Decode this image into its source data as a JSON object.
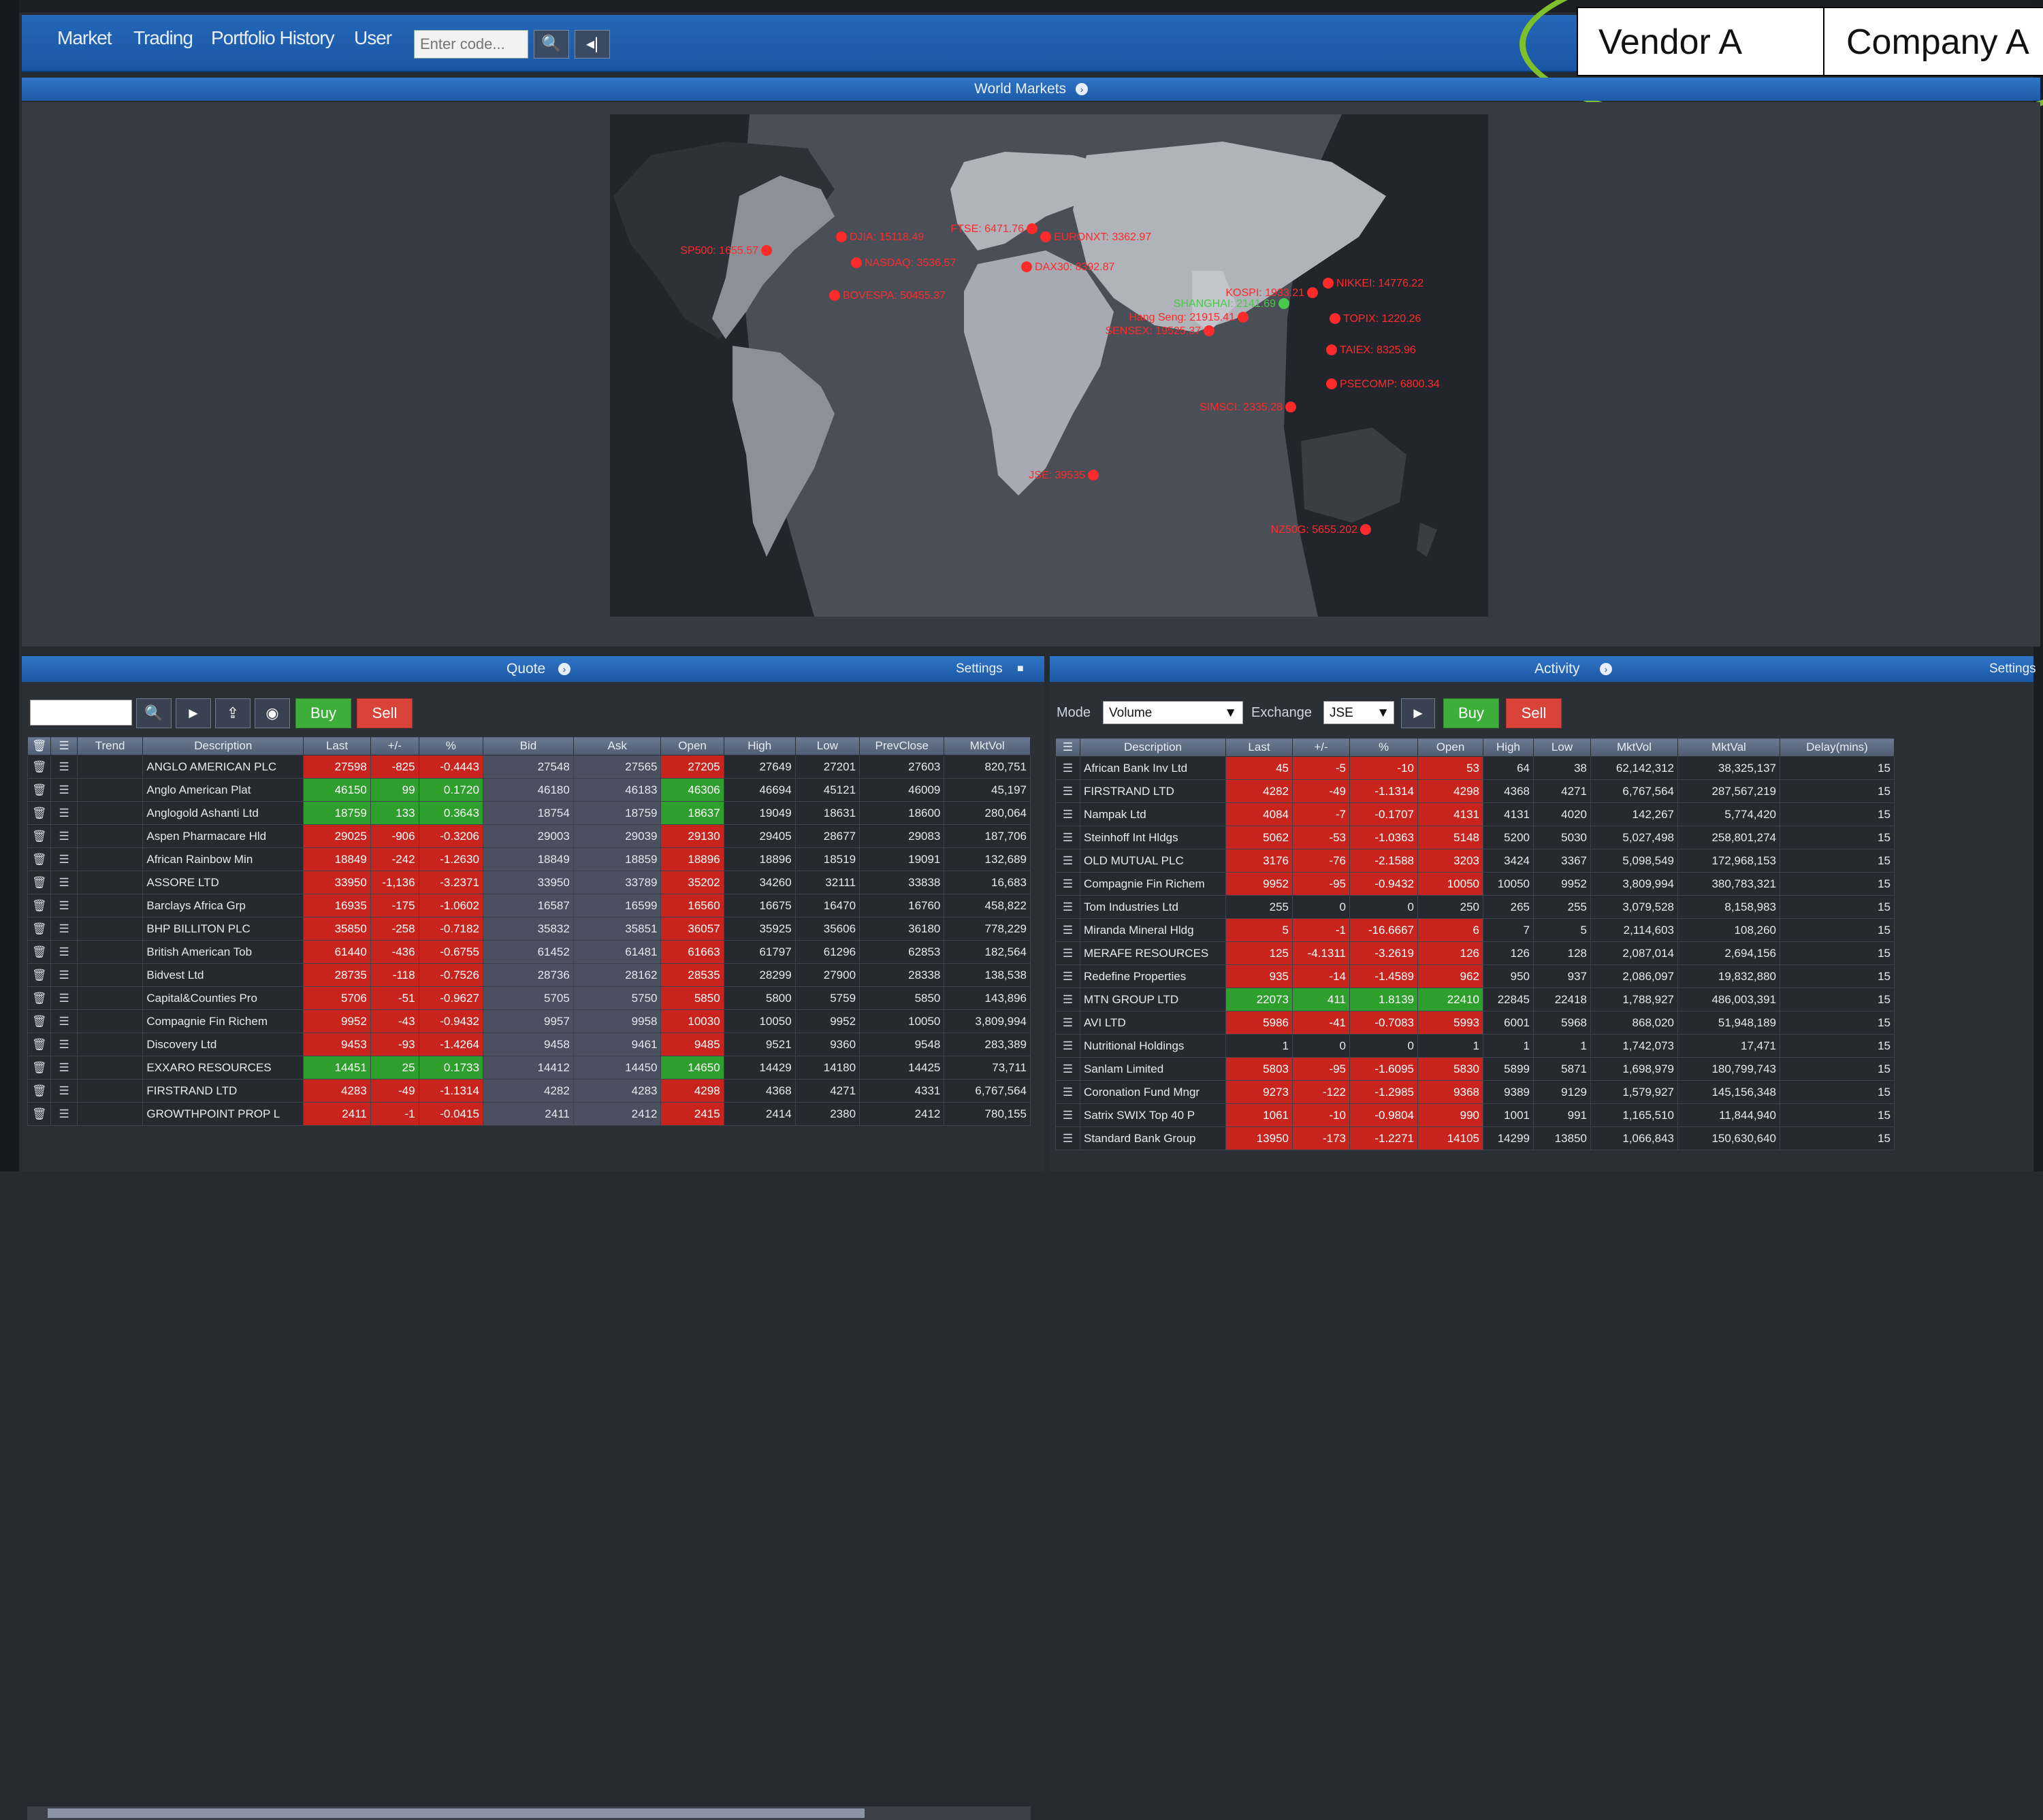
{
  "nav": {
    "items": [
      "Market",
      "Trading",
      "Portfolio History",
      "User"
    ],
    "search_placeholder": "Enter code...",
    "search_button": "🔍",
    "back_button": "◂|"
  },
  "annotation": {
    "vendor": "Vendor A",
    "company": "Company A"
  },
  "world_markets": {
    "title": "World Markets",
    "markers": [
      {
        "label": "SP500: 1655.57",
        "color": "#ff2a2a"
      },
      {
        "label": "DJIA: 15118.49",
        "color": "#ff2a2a"
      },
      {
        "label": "NASDAQ: 3536.57",
        "color": "#ff2a2a"
      },
      {
        "label": "BOVESPA: 50455.37",
        "color": "#ff2a2a"
      },
      {
        "label": "FTSE: 6471.76",
        "color": "#ff2a2a"
      },
      {
        "label": "EURONXT: 3362.97",
        "color": "#ff2a2a"
      },
      {
        "label": "DAX30: 8392.87",
        "color": "#ff2a2a"
      },
      {
        "label": "JSE: 39535",
        "color": "#ff2a2a"
      },
      {
        "label": "SENSEX: 19525.37",
        "color": "#ff2a2a"
      },
      {
        "label": "Hang Seng: 21915.41",
        "color": "#ff2a2a"
      },
      {
        "label": "SHANGHAI: 2141.69",
        "color": "#49c94a"
      },
      {
        "label": "KOSPI: 1933.21",
        "color": "#ff2a2a"
      },
      {
        "label": "NIKKEI: 14776.22",
        "color": "#ff2a2a"
      },
      {
        "label": "TOPIX: 1220.26",
        "color": "#ff2a2a"
      },
      {
        "label": "TAIEX: 8325.96",
        "color": "#ff2a2a"
      },
      {
        "label": "PSECOMP: 6800.34",
        "color": "#ff2a2a"
      },
      {
        "label": "SIMSCI: 2335.28",
        "color": "#ff2a2a"
      },
      {
        "label": "NZ50G: 5655.202",
        "color": "#ff2a2a"
      }
    ]
  },
  "quote": {
    "title": "Quote",
    "settings": "Settings",
    "buy": "Buy",
    "sell": "Sell",
    "columns": [
      "Trend",
      "Description",
      "Last",
      "+/-",
      "%",
      "Bid",
      "Ask",
      "Open",
      "High",
      "Low",
      "PrevClose",
      "MktVol"
    ],
    "rows": [
      [
        "ANGLO AMERICAN PLC",
        "27598",
        "-825",
        "-0.4443",
        "27548",
        "27565",
        "27205",
        "27649",
        "27201",
        "27603",
        "820,751"
      ],
      [
        "Anglo American Plat",
        "46150",
        "99",
        "0.1720",
        "46180",
        "46183",
        "46306",
        "46694",
        "45121",
        "46009",
        "45,197"
      ],
      [
        "Anglogold Ashanti Ltd",
        "18759",
        "133",
        "0.3643",
        "18754",
        "18759",
        "18637",
        "19049",
        "18631",
        "18600",
        "280,064"
      ],
      [
        "Aspen Pharmacare Hld",
        "29025",
        "-906",
        "-0.3206",
        "29003",
        "29039",
        "29130",
        "29405",
        "28677",
        "29083",
        "187,706"
      ],
      [
        "African Rainbow Min",
        "18849",
        "-242",
        "-1.2630",
        "18849",
        "18859",
        "18896",
        "18896",
        "18519",
        "19091",
        "132,689"
      ],
      [
        "ASSORE LTD",
        "33950",
        "-1,136",
        "-3.2371",
        "33950",
        "33789",
        "35202",
        "34260",
        "32111",
        "33838",
        "16,683"
      ],
      [
        "Barclays Africa Grp",
        "16935",
        "-175",
        "-1.0602",
        "16587",
        "16599",
        "16560",
        "16675",
        "16470",
        "16760",
        "458,822"
      ],
      [
        "BHP BILLITON PLC",
        "35850",
        "-258",
        "-0.7182",
        "35832",
        "35851",
        "36057",
        "35925",
        "35606",
        "36180",
        "778,229"
      ],
      [
        "British American Tob",
        "61440",
        "-436",
        "-0.6755",
        "61452",
        "61481",
        "61663",
        "61797",
        "61296",
        "62853",
        "182,564"
      ],
      [
        "Bidvest Ltd",
        "28735",
        "-118",
        "-0.7526",
        "28736",
        "28162",
        "28535",
        "28299",
        "27900",
        "28338",
        "138,538"
      ],
      [
        "Capital&Counties Pro",
        "5706",
        "-51",
        "-0.9627",
        "5705",
        "5750",
        "5850",
        "5800",
        "5759",
        "5850",
        "143,896"
      ],
      [
        "Compagnie Fin Richem",
        "9952",
        "-43",
        "-0.9432",
        "9957",
        "9958",
        "10030",
        "10050",
        "9952",
        "10050",
        "3,809,994"
      ],
      [
        "Discovery Ltd",
        "9453",
        "-93",
        "-1.4264",
        "9458",
        "9461",
        "9485",
        "9521",
        "9360",
        "9548",
        "283,389"
      ],
      [
        "EXXARO RESOURCES",
        "14451",
        "25",
        "0.1733",
        "14412",
        "14450",
        "14650",
        "14429",
        "14180",
        "14425",
        "73,711"
      ],
      [
        "FIRSTRAND LTD",
        "4283",
        "-49",
        "-1.1314",
        "4282",
        "4283",
        "4298",
        "4368",
        "4271",
        "4331",
        "6,767,564"
      ],
      [
        "GROWTHPOINT PROP L",
        "2411",
        "-1",
        "-0.0415",
        "2411",
        "2412",
        "2415",
        "2414",
        "2380",
        "2412",
        "780,155"
      ]
    ]
  },
  "activity": {
    "title": "Activity",
    "settings": "Settings",
    "mode_label": "Mode",
    "mode_value": "Volume",
    "exchange_label": "Exchange",
    "exchange_value": "JSE",
    "buy": "Buy",
    "sell": "Sell",
    "columns": [
      "Description",
      "Last",
      "+/-",
      "%",
      "Open",
      "High",
      "Low",
      "MktVol",
      "MktVal",
      "Delay(mins)"
    ],
    "rows": [
      [
        "African Bank Inv Ltd",
        "45",
        "-5",
        "-10",
        "53",
        "64",
        "38",
        "62,142,312",
        "38,325,137",
        "15"
      ],
      [
        "FIRSTRAND LTD",
        "4282",
        "-49",
        "-1.1314",
        "4298",
        "4368",
        "4271",
        "6,767,564",
        "287,567,219",
        "15"
      ],
      [
        "Nampak Ltd",
        "4084",
        "-7",
        "-0.1707",
        "4131",
        "4131",
        "4020",
        "142,267",
        "5,774,420",
        "15"
      ],
      [
        "Steinhoff Int Hldgs",
        "5062",
        "-53",
        "-1.0363",
        "5148",
        "5200",
        "5030",
        "5,027,498",
        "258,801,274",
        "15"
      ],
      [
        "OLD MUTUAL PLC",
        "3176",
        "-76",
        "-2.1588",
        "3203",
        "3424",
        "3367",
        "5,098,549",
        "172,968,153",
        "15"
      ],
      [
        "Compagnie Fin Richem",
        "9952",
        "-95",
        "-0.9432",
        "10050",
        "10050",
        "9952",
        "3,809,994",
        "380,783,321",
        "15"
      ],
      [
        "Tom Industries Ltd",
        "255",
        "0",
        "0",
        "250",
        "265",
        "255",
        "3,079,528",
        "8,158,983",
        "15"
      ],
      [
        "Miranda Mineral Hldg",
        "5",
        "-1",
        "-16.6667",
        "6",
        "7",
        "5",
        "2,114,603",
        "108,260",
        "15"
      ],
      [
        "MERAFE RESOURCES",
        "125",
        "-4.1311",
        "-3.2619",
        "126",
        "126",
        "128",
        "2,087,014",
        "2,694,156",
        "15"
      ],
      [
        "Redefine Properties",
        "935",
        "-14",
        "-1.4589",
        "962",
        "950",
        "937",
        "2,086,097",
        "19,832,880",
        "15"
      ],
      [
        "MTN GROUP LTD",
        "22073",
        "411",
        "1.8139",
        "22410",
        "22845",
        "22418",
        "1,788,927",
        "486,003,391",
        "15"
      ],
      [
        "AVI LTD",
        "5986",
        "-41",
        "-0.7083",
        "5993",
        "6001",
        "5968",
        "868,020",
        "51,948,189",
        "15"
      ],
      [
        "Nutritional Holdings",
        "1",
        "0",
        "0",
        "1",
        "1",
        "1",
        "1,742,073",
        "17,471",
        "15"
      ],
      [
        "Sanlam Limited",
        "5803",
        "-95",
        "-1.6095",
        "5830",
        "5899",
        "5871",
        "1,698,979",
        "180,799,743",
        "15"
      ],
      [
        "Coronation Fund Mngr",
        "9273",
        "-122",
        "-1.2985",
        "9368",
        "9389",
        "9129",
        "1,579,927",
        "145,156,348",
        "15"
      ],
      [
        "Satrix SWIX Top 40 P",
        "1061",
        "-10",
        "-0.9804",
        "990",
        "1001",
        "991",
        "1,165,510",
        "11,844,940",
        "15"
      ],
      [
        "Standard Bank Group",
        "13950",
        "-173",
        "-1.2271",
        "14105",
        "14299",
        "13850",
        "1,066,843",
        "150,630,640",
        "15"
      ]
    ]
  }
}
